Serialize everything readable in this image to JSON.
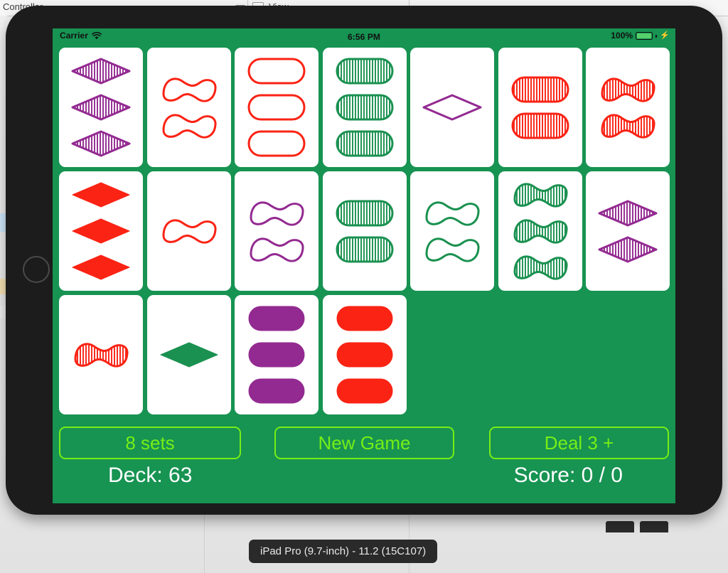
{
  "desktop": {
    "app_menu_label": "Controller",
    "view_label": "View",
    "dropdown_icon": "triangle-down-icon",
    "checkbox_icon": "checkbox-icon"
  },
  "simulator": {
    "caption": "iPad Pro (9.7-inch) - 11.2 (15C107)",
    "home_button_icon": "home-button-icon"
  },
  "status_bar": {
    "carrier": "Carrier",
    "wifi_icon": "wifi-icon",
    "time": "6:56 PM",
    "battery_percent": "100%",
    "battery_icon": "battery-icon",
    "charging_icon": "lightning-bolt-icon"
  },
  "theme": {
    "table_green": "#179352",
    "card_white": "#ffffff",
    "accent_green": "#76ee16",
    "shape_red": "#fa2314",
    "shape_green": "#1a9150",
    "shape_purple": "#932a91",
    "status_text": "#ffffff"
  },
  "controls": {
    "sets_label": "8 sets",
    "new_game_label": "New Game",
    "deal_label": "Deal 3 +",
    "deck_label": "Deck: 63",
    "score_label": "Score: 0 / 0"
  },
  "board": {
    "columns": 7,
    "rows": 3,
    "cards": [
      {
        "id": 1,
        "count": 3,
        "color": "purple",
        "shape": "diamond",
        "fill": "striped"
      },
      {
        "id": 2,
        "count": 2,
        "color": "red",
        "shape": "squiggle",
        "fill": "open"
      },
      {
        "id": 3,
        "count": 3,
        "color": "red",
        "shape": "pill",
        "fill": "open"
      },
      {
        "id": 4,
        "count": 3,
        "color": "green",
        "shape": "pill",
        "fill": "striped"
      },
      {
        "id": 5,
        "count": 1,
        "color": "purple",
        "shape": "diamond",
        "fill": "open"
      },
      {
        "id": 6,
        "count": 2,
        "color": "red",
        "shape": "pill",
        "fill": "striped"
      },
      {
        "id": 7,
        "count": 2,
        "color": "red",
        "shape": "squiggle",
        "fill": "striped"
      },
      {
        "id": 8,
        "count": 3,
        "color": "red",
        "shape": "diamond",
        "fill": "solid"
      },
      {
        "id": 9,
        "count": 1,
        "color": "red",
        "shape": "squiggle",
        "fill": "open"
      },
      {
        "id": 10,
        "count": 2,
        "color": "purple",
        "shape": "squiggle",
        "fill": "open"
      },
      {
        "id": 11,
        "count": 2,
        "color": "green",
        "shape": "pill",
        "fill": "striped"
      },
      {
        "id": 12,
        "count": 2,
        "color": "green",
        "shape": "squiggle",
        "fill": "open"
      },
      {
        "id": 13,
        "count": 3,
        "color": "green",
        "shape": "squiggle",
        "fill": "striped"
      },
      {
        "id": 14,
        "count": 2,
        "color": "purple",
        "shape": "diamond",
        "fill": "striped"
      },
      {
        "id": 15,
        "count": 1,
        "color": "red",
        "shape": "squiggle",
        "fill": "striped"
      },
      {
        "id": 16,
        "count": 1,
        "color": "green",
        "shape": "diamond",
        "fill": "solid"
      },
      {
        "id": 17,
        "count": 3,
        "color": "purple",
        "shape": "pill",
        "fill": "solid"
      },
      {
        "id": 18,
        "count": 3,
        "color": "red",
        "shape": "pill",
        "fill": "solid"
      }
    ]
  }
}
